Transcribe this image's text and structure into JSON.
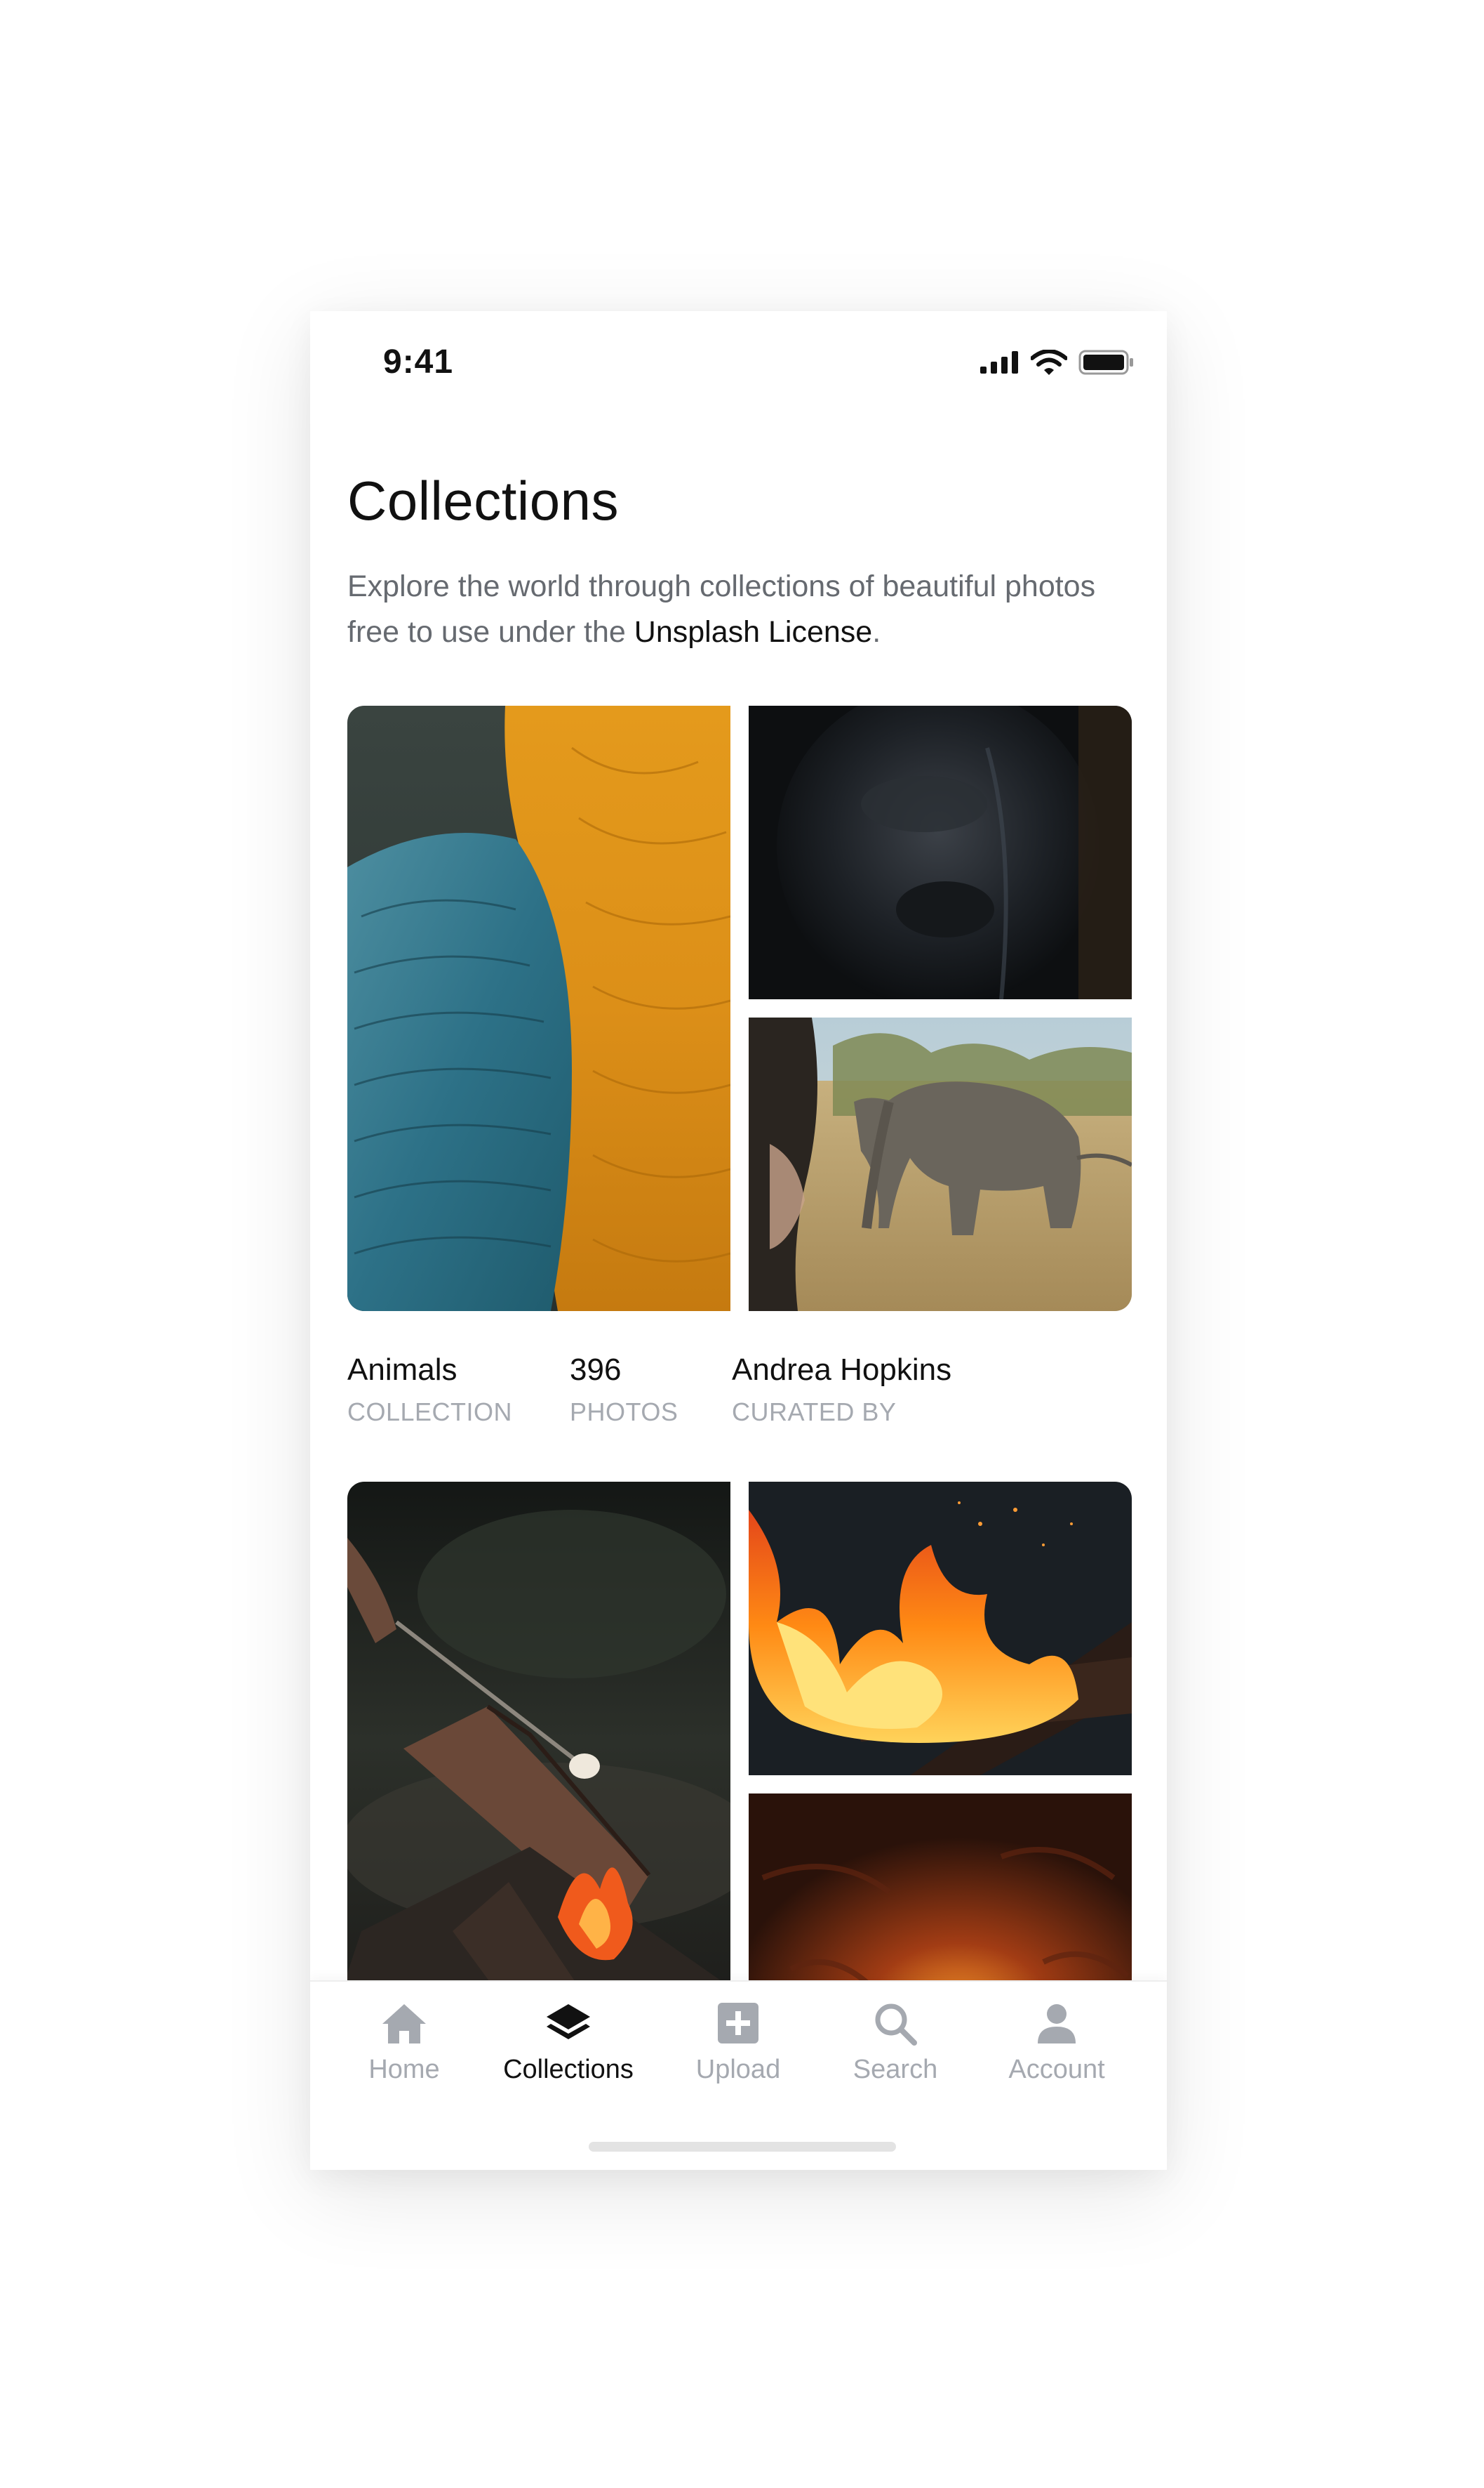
{
  "status_bar": {
    "time": "9:41",
    "icons": [
      "cellular-signal-icon",
      "wifi-icon",
      "battery-icon"
    ]
  },
  "header": {
    "title": "Collections",
    "description_prefix": "Explore the world through collections of beautiful photos free to use under the ",
    "license_link": "Unsplash License",
    "description_suffix": "."
  },
  "collections": [
    {
      "stats": [
        {
          "value": "Animals",
          "label": "COLLECTION"
        },
        {
          "value": "396",
          "label": "PHOTOS"
        },
        {
          "value": "Andrea Hopkins",
          "label": "CURATED BY"
        }
      ]
    },
    {}
  ],
  "tab_bar": {
    "tabs": [
      {
        "label": "Home",
        "icon": "home-icon"
      },
      {
        "label": "Collections",
        "icon": "layers-icon",
        "active": true
      },
      {
        "label": "Upload",
        "icon": "plus-square-icon"
      },
      {
        "label": "Search",
        "icon": "search-icon"
      },
      {
        "label": "Account",
        "icon": "user-icon"
      }
    ]
  },
  "colors": {
    "text_primary": "#111111",
    "text_secondary": "#666a70",
    "text_muted": "#a5a9b0",
    "background": "#ffffff"
  }
}
